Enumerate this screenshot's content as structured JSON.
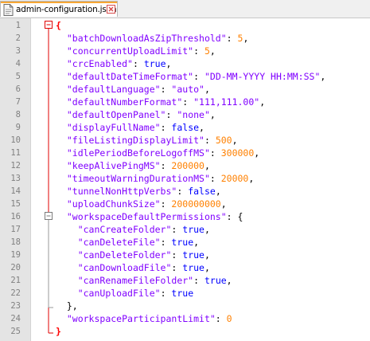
{
  "tab": {
    "filename": "admin-configuration.json",
    "icon": "file-icon",
    "close_icon": "close-icon"
  },
  "colors": {
    "string": "#8000ff",
    "number": "#ff8000",
    "boolean": "#0000ff",
    "gutter_bg": "#e4e4e4",
    "fold_line": "#e00000",
    "tab_accent": "#f7a734"
  },
  "lines": [
    {
      "n": "1",
      "indent": "",
      "key": "",
      "val": "",
      "vt": "open",
      "trail": ""
    },
    {
      "n": "2",
      "indent": "  ",
      "key": "\"batchDownloadAsZipThreshold\"",
      "val": "5",
      "vt": "n",
      "trail": ","
    },
    {
      "n": "3",
      "indent": "  ",
      "key": "\"concurrentUploadLimit\"",
      "val": "5",
      "vt": "n",
      "trail": ","
    },
    {
      "n": "4",
      "indent": "  ",
      "key": "\"crcEnabled\"",
      "val": "true",
      "vt": "b",
      "trail": ","
    },
    {
      "n": "5",
      "indent": "  ",
      "key": "\"defaultDateTimeFormat\"",
      "val": "\"DD-MM-YYYY HH:MM:SS\"",
      "vt": "s",
      "trail": ","
    },
    {
      "n": "6",
      "indent": "  ",
      "key": "\"defaultLanguage\"",
      "val": "\"auto\"",
      "vt": "s",
      "trail": ","
    },
    {
      "n": "7",
      "indent": "  ",
      "key": "\"defaultNumberFormat\"",
      "val": "\"111,111.00\"",
      "vt": "s",
      "trail": ","
    },
    {
      "n": "8",
      "indent": "  ",
      "key": "\"defaultOpenPanel\"",
      "val": "\"none\"",
      "vt": "s",
      "trail": ","
    },
    {
      "n": "9",
      "indent": "  ",
      "key": "\"displayFullName\"",
      "val": "false",
      "vt": "b",
      "trail": ","
    },
    {
      "n": "10",
      "indent": "  ",
      "key": "\"fileListingDisplayLimit\"",
      "val": "500",
      "vt": "n",
      "trail": ","
    },
    {
      "n": "11",
      "indent": "  ",
      "key": "\"idlePeriodBeforeLogoffMS\"",
      "val": "300000",
      "vt": "n",
      "trail": ","
    },
    {
      "n": "12",
      "indent": "  ",
      "key": "\"keepAlivePingMS\"",
      "val": "200000",
      "vt": "n",
      "trail": ","
    },
    {
      "n": "13",
      "indent": "  ",
      "key": "\"timeoutWarningDurationMS\"",
      "val": "20000",
      "vt": "n",
      "trail": ","
    },
    {
      "n": "14",
      "indent": "  ",
      "key": "\"tunnelNonHttpVerbs\"",
      "val": "false",
      "vt": "b",
      "trail": ","
    },
    {
      "n": "15",
      "indent": "  ",
      "key": "\"uploadChunkSize\"",
      "val": "200000000",
      "vt": "n",
      "trail": ","
    },
    {
      "n": "16",
      "indent": "  ",
      "key": "\"workspaceDefaultPermissions\"",
      "val": "{",
      "vt": "p",
      "trail": ""
    },
    {
      "n": "17",
      "indent": "    ",
      "key": "\"canCreateFolder\"",
      "val": "true",
      "vt": "b",
      "trail": ","
    },
    {
      "n": "18",
      "indent": "    ",
      "key": "\"canDeleteFile\"",
      "val": "true",
      "vt": "b",
      "trail": ","
    },
    {
      "n": "19",
      "indent": "    ",
      "key": "\"canDeleteFolder\"",
      "val": "true",
      "vt": "b",
      "trail": ","
    },
    {
      "n": "20",
      "indent": "    ",
      "key": "\"canDownloadFile\"",
      "val": "true",
      "vt": "b",
      "trail": ","
    },
    {
      "n": "21",
      "indent": "    ",
      "key": "\"canRenameFileFolder\"",
      "val": "true",
      "vt": "b",
      "trail": ","
    },
    {
      "n": "22",
      "indent": "    ",
      "key": "\"canUploadFile\"",
      "val": "true",
      "vt": "b",
      "trail": ""
    },
    {
      "n": "23",
      "indent": "  ",
      "key": "",
      "val": "},",
      "vt": "p",
      "trail": ""
    },
    {
      "n": "24",
      "indent": "  ",
      "key": "\"workspaceParticipantLimit\"",
      "val": "0",
      "vt": "n",
      "trail": ""
    },
    {
      "n": "25",
      "indent": "",
      "key": "",
      "val": "}",
      "vt": "close",
      "trail": ""
    }
  ]
}
